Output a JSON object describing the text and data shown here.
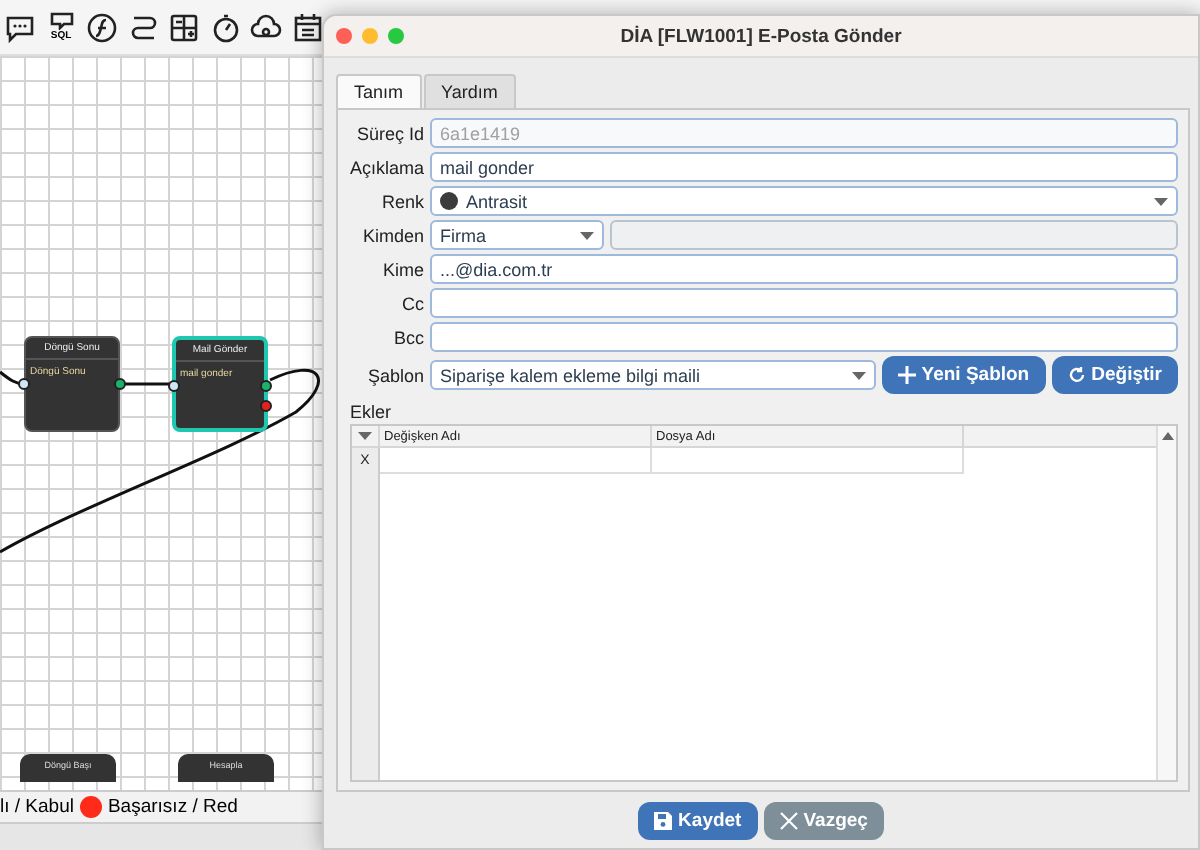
{
  "toolbar": [
    {
      "kind": "chat"
    },
    {
      "kind": "sql",
      "label": "SQL"
    },
    {
      "kind": "function"
    },
    {
      "kind": "route"
    },
    {
      "kind": "calculator"
    },
    {
      "kind": "timer"
    },
    {
      "kind": "cloud"
    },
    {
      "kind": "calendar"
    }
  ],
  "canvas": {
    "nodes": [
      {
        "title": "Döngü Sonu",
        "subtitle": "Döngü Sonu",
        "selected": false
      },
      {
        "title": "Mail Gönder",
        "subtitle": "mail gonder",
        "selected": true
      }
    ],
    "partial_nodes": [
      {
        "title": "Döngü Başı"
      },
      {
        "title": "Hesapla"
      }
    ]
  },
  "status_bar": {
    "legend": [
      {
        "label": "lı / Kabul"
      },
      {
        "label": "Başarısız / Red",
        "color": "#ff2a1a"
      }
    ]
  },
  "dialog": {
    "title": "DİA [FLW1001] E-Posta Gönder",
    "tabs": [
      {
        "label": "Tanım",
        "selected": true
      },
      {
        "label": "Yardım",
        "selected": false
      }
    ],
    "fields": [
      {
        "label": "Süreç Id",
        "kind": "text",
        "value": "6a1e1419",
        "disabled": true
      },
      {
        "label": "Açıklama",
        "kind": "text",
        "value": "mail gonder",
        "disabled": false
      },
      {
        "label": "Renk",
        "kind": "color-select",
        "value": "Antrasit",
        "color": "#3c3c3c"
      },
      {
        "label": "Kimden",
        "kind": "select-pair",
        "value": "Firma"
      },
      {
        "label": "Kime",
        "kind": "text",
        "value": "...@dia.com.tr",
        "disabled": false
      },
      {
        "label": "Cc",
        "kind": "text"
      },
      {
        "label": "Bcc",
        "kind": "text"
      },
      {
        "label": "Şablon",
        "kind": "select-buttons",
        "value": "Siparişe kalem ekleme bilgi maili",
        "buttons": [
          {
            "label": "Yeni Şablon",
            "kind": "add"
          },
          {
            "label": "Değiştir",
            "kind": "change"
          }
        ]
      }
    ],
    "attachments": {
      "label": "Ekler",
      "columns": [
        "Değişken Adı",
        "Dosya Adı"
      ],
      "rows": [
        {
          "row_header": "X"
        }
      ]
    },
    "buttons": [
      {
        "label": "Kaydet",
        "kind": "save"
      },
      {
        "label": "Vazgeç",
        "kind": "cancel"
      }
    ]
  }
}
